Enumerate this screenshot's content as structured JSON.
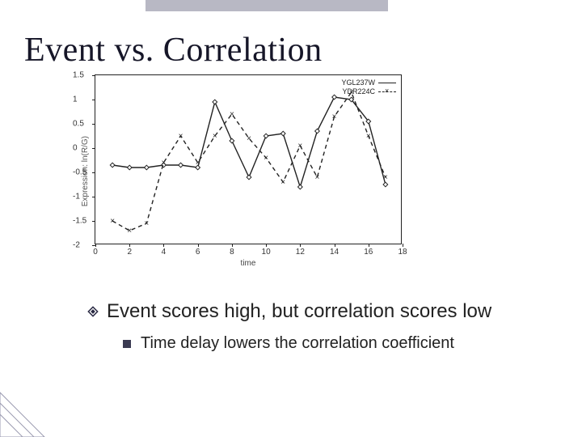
{
  "title": "Event vs. Correlation",
  "chart_data": {
    "type": "line",
    "xlabel": "time",
    "ylabel": "Expression: ln(R/G)",
    "xlim": [
      0,
      18
    ],
    "ylim": [
      -2,
      1.5
    ],
    "xticks": [
      0,
      2,
      4,
      6,
      8,
      10,
      12,
      14,
      16,
      18
    ],
    "yticks": [
      -2,
      -1.5,
      -1,
      -0.5,
      0,
      0.5,
      1,
      1.5
    ],
    "series": [
      {
        "name": "YGL237W",
        "style": "solid",
        "x": [
          1,
          2,
          3,
          4,
          5,
          6,
          7,
          8,
          9,
          10,
          11,
          12,
          13,
          14,
          15,
          16,
          17
        ],
        "values": [
          -0.35,
          -0.4,
          -0.4,
          -0.35,
          -0.35,
          -0.4,
          0.95,
          0.15,
          -0.6,
          0.25,
          0.3,
          -0.8,
          0.35,
          1.05,
          1.0,
          0.55,
          -0.75
        ]
      },
      {
        "name": "YDR224C",
        "style": "dash-x",
        "x": [
          1,
          2,
          3,
          4,
          5,
          6,
          7,
          8,
          9,
          10,
          11,
          12,
          13,
          14,
          15,
          16,
          17
        ],
        "values": [
          -1.5,
          -1.7,
          -1.55,
          -0.3,
          0.25,
          -0.3,
          0.25,
          0.7,
          0.2,
          -0.2,
          -0.7,
          0.05,
          -0.6,
          0.65,
          1.15,
          0.25,
          -0.6
        ]
      }
    ]
  },
  "bullets": {
    "level1": "Event scores high, but correlation scores low",
    "level2": "Time delay lowers the correlation coefficient"
  }
}
